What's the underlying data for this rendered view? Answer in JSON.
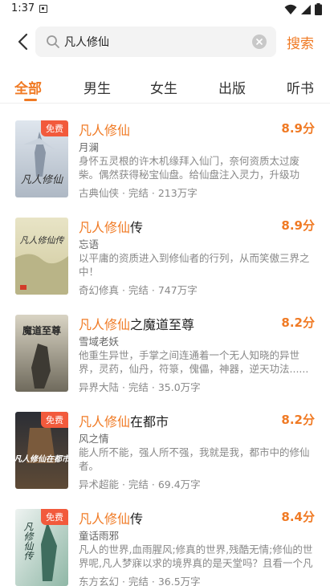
{
  "status_bar": {
    "time": "1:37"
  },
  "search": {
    "query": "凡人修仙",
    "button_label": "搜索"
  },
  "tabs": [
    {
      "label": "全部",
      "active": true
    },
    {
      "label": "男生",
      "active": false
    },
    {
      "label": "女生",
      "active": false
    },
    {
      "label": "出版",
      "active": false
    },
    {
      "label": "听书",
      "active": false
    }
  ],
  "books": [
    {
      "title_highlight": "凡人修仙",
      "title_rest": "",
      "score": "8.9分",
      "author": "月澜",
      "description": "身怀五灵根的许木机缘拜入仙门，奈何资质太过废柴。偶然获得秘宝仙盘。给仙盘注入灵力，升级功法，",
      "meta": "古典仙侠 · 完结 · 213万字",
      "free_badge": "免费",
      "cover_text": "凡人修仙"
    },
    {
      "title_highlight": "凡人修仙",
      "title_rest": "传",
      "score": "8.9分",
      "author": "忘语",
      "description": "以平庸的资质进入到修仙者的行列，从而笑傲三界之中！",
      "meta": "奇幻修真 · 完结 · 747万字",
      "free_badge": "",
      "cover_text": "凡人修仙传"
    },
    {
      "title_highlight": "凡人修仙",
      "title_rest": "之魔道至尊",
      "score": "8.2分",
      "author": "雪域老妖",
      "description": "他重生异世，手掌之间连通着一个无人知晓的异世界，灵药，仙丹，符箓，傀儡，神器，逆天功法......",
      "meta": "异界大陆 · 完结 · 35.0万字",
      "free_badge": "",
      "cover_text": "魔道至尊"
    },
    {
      "title_highlight": "凡人修仙",
      "title_rest": "在都市",
      "score": "8.2分",
      "author": "风之情",
      "description": "能人所不能，强人所不强，我就是我，都市中的修仙者。",
      "meta": "异术超能 · 完结 · 69.4万字",
      "free_badge": "免费",
      "cover_text": "凡人修仙在都市"
    },
    {
      "title_highlight": "凡人修仙",
      "title_rest": "传",
      "score": "8.4分",
      "author": "童话雨邪",
      "description": "凡人的世界,血雨腥风;修真的世界,残酷无情;修仙的世界呢,凡人梦寐以求的境界真的是天堂吗？且看一个凡人修仙的故事。",
      "meta": "东方玄幻 · 完结 · 36.5万字",
      "free_badge": "免费",
      "cover_text": "凡修仙传"
    }
  ],
  "colors": {
    "accent": "#f07a24",
    "badge": "#f25a3c"
  },
  "icons": [
    "signal-icon",
    "wifi-icon",
    "battery-icon",
    "back-arrow-icon",
    "search-icon",
    "clear-icon"
  ]
}
